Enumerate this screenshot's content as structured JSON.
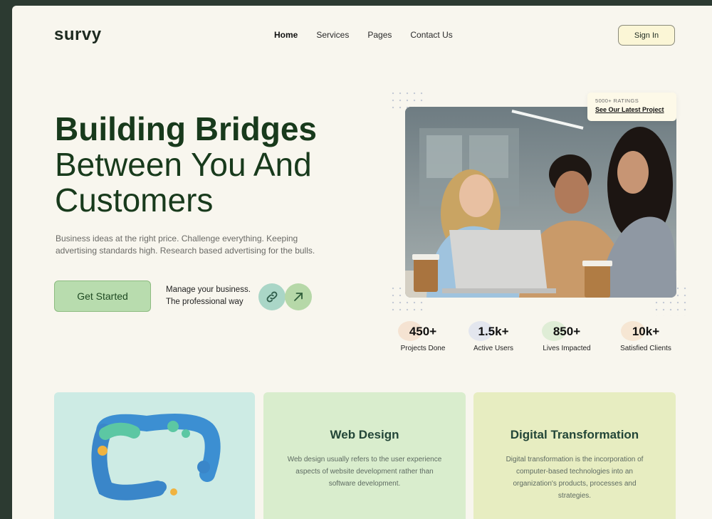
{
  "brand": {
    "logo": "survy"
  },
  "nav": {
    "items": [
      "Home",
      "Services",
      "Pages",
      "Contact Us"
    ],
    "active": "Home",
    "signin": "Sign In"
  },
  "hero": {
    "title_line1": "Building Bridges",
    "title_line2": "Between You And",
    "title_line3": "Customers",
    "subtext": "Business ideas at the right price. Challenge everything. Keeping advertising standards high. Research based advertising for the bulls.",
    "cta": "Get Started",
    "manage_line1": "Manage your business.",
    "manage_line2": "The professional way"
  },
  "ratings_card": {
    "label": "5000+ RATINGS",
    "link": "See Our Latest Project"
  },
  "stats": [
    {
      "value": "450+",
      "label": "Projects Done",
      "color": "#f4d7c0"
    },
    {
      "value": "1.5k+",
      "label": "Active Users",
      "color": "#d5dcef"
    },
    {
      "value": "850+",
      "label": "Lives Impacted",
      "color": "#cfe7c6"
    },
    {
      "value": "10k+",
      "label": "Satisfied Clients",
      "color": "#f5dcc2"
    }
  ],
  "cards": [
    {
      "title": "",
      "text": ""
    },
    {
      "title": "Web Design",
      "text": "Web design usually refers to the user experience aspects of website development rather than software development."
    },
    {
      "title": "Digital Transformation",
      "text": "Digital transformation is the incorporation of computer-based technologies into an organization's products, processes and strategies."
    }
  ],
  "colors": {
    "accent": "#b8dcae",
    "heading": "#183a1c",
    "background": "#f8f6ee"
  }
}
